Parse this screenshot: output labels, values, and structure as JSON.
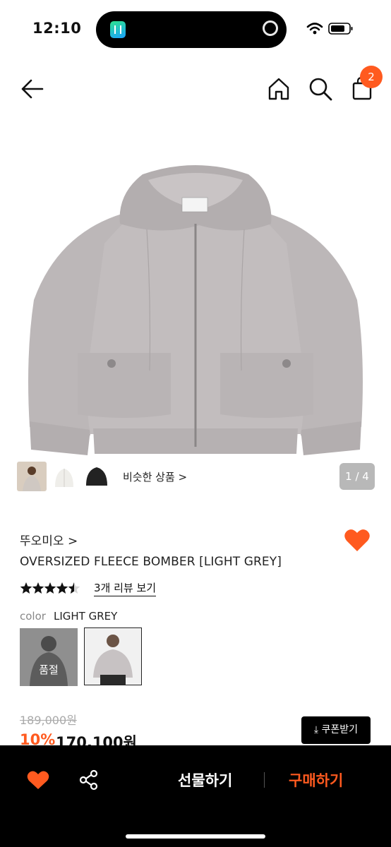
{
  "status_bar": {
    "time": "12:10"
  },
  "nav": {
    "cart_count": "2"
  },
  "gallery": {
    "similar_label": "비슷한 상품 >",
    "counter": "1 / 4"
  },
  "product": {
    "brand": "뚜오미오 >",
    "title": "OVERSIZED FLEECE BOMBER [LIGHT GREY]",
    "rating": 4.5,
    "review_link": "3개 리뷰 보기",
    "color_label": "color",
    "color_value": "LIGHT GREY",
    "sold_out_label": "품절",
    "original_price": "189,000원",
    "discount": "10%",
    "price": "170,100원",
    "coupon_label": "⤓ 쿠폰받기"
  },
  "bottom_bar": {
    "gift_label": "선물하기",
    "buy_label": "구매하기"
  },
  "colors": {
    "accent": "#ff5a1f",
    "bottom_bar": "#000000",
    "product_grey": "#bdb8b9"
  }
}
